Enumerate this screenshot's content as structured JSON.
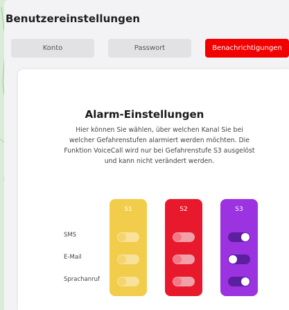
{
  "page": {
    "title": "Benutzereinstellungen"
  },
  "tabs": [
    {
      "label": "Konto",
      "active": false
    },
    {
      "label": "Passwort",
      "active": false
    },
    {
      "label": "Benachrichtigungen",
      "active": true
    }
  ],
  "alarm": {
    "title": "Alarm-Einstellungen",
    "description": "Hier können Sie wählen, über welchen Kanal Sie bei welcher Gefahrenstufen alarmiert werden möchten. Die Funktion VoiceCall wird nur bei Gefahrenstufe S3 ausgelöst und kann nicht verändert werden.",
    "rows": [
      "SMS",
      "E-Mail",
      "Sprachanruf"
    ],
    "levels": [
      {
        "label": "S1",
        "color": "#f2cd4b",
        "track": "#f8e29a",
        "knob": "#f5d46a",
        "toggles": [
          false,
          false,
          false
        ]
      },
      {
        "label": "S2",
        "color": "#e8192c",
        "track": "#f0a0a8",
        "knob": "#f37883",
        "toggles": [
          false,
          false,
          false
        ]
      },
      {
        "label": "S3",
        "color": "#9b33e0",
        "track": "#5b1fa0",
        "knob": "#ffffff",
        "toggles": [
          true,
          false,
          true
        ]
      }
    ]
  },
  "colors": {
    "accent": "#f20000"
  }
}
